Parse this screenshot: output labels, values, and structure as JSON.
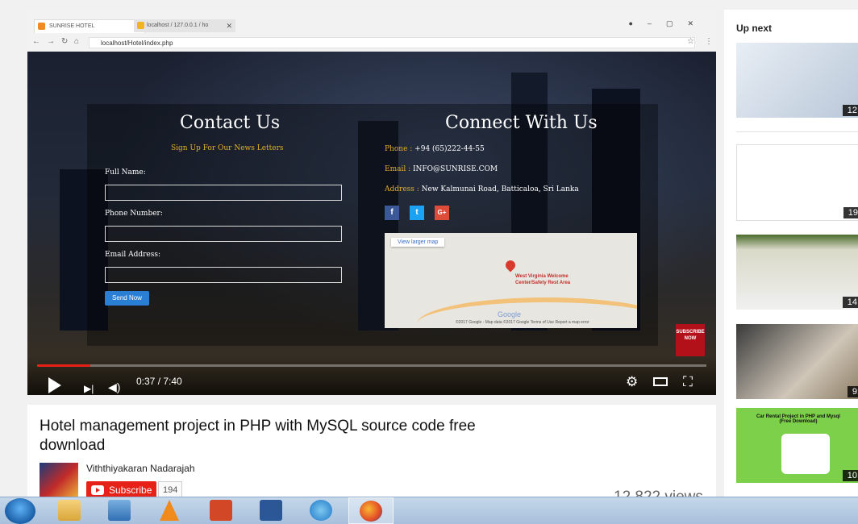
{
  "browser": {
    "tabs": [
      {
        "label": "SUNRISE HOTEL",
        "close": "✕"
      },
      {
        "label": "localhost / 127.0.0.1 / ho",
        "close": "✕"
      }
    ],
    "address": "localhost/Hotel/index.php"
  },
  "site": {
    "contact_title": "Contact Us",
    "newsletter_text": "Sign Up For Our News Letters",
    "fields": [
      {
        "label": "Full Name:"
      },
      {
        "label": "Phone Number:"
      },
      {
        "label": "Email Address:"
      }
    ],
    "send_label": "Send Now",
    "connect_title": "Connect With Us",
    "phone": {
      "label": "Phone :",
      "value": "+94 (65)222-44-55"
    },
    "email": {
      "label": "Email :",
      "value": "INFO@SUNRISE.COM"
    },
    "address": {
      "label": "Address :",
      "value": "New Kalmunai Road, Batticaloa, Sri Lanka"
    },
    "social": [
      {
        "glyph": "f",
        "color": "#3b5998"
      },
      {
        "glyph": "t",
        "color": "#1da1f2"
      },
      {
        "glyph": "G+",
        "color": "#dd4b39"
      }
    ],
    "map": {
      "larger_map": "View larger map",
      "place": "West Virginia Welcome Center/Safety Rest Area",
      "google": "Google",
      "footer": "©2017 Google - Map data ©2017 Google   Terms of Use   Report a map error"
    },
    "subscribe_badge": "SUBSCRIBE NOW"
  },
  "player": {
    "time": "0:37 / 7:40",
    "progress_fraction": 0.08
  },
  "video": {
    "title": "Hotel management project in PHP with MySQL source code free download",
    "channel": "Viththiyakaran Nadarajah",
    "subscribe_label": "Subscribe",
    "subscriber_count": "194",
    "views": "12,822 views"
  },
  "sidebar": {
    "heading": "Up next",
    "items": [
      {
        "duration": "12:"
      },
      {
        "duration": "19:"
      },
      {
        "duration": "14:"
      },
      {
        "duration": "9:"
      },
      {
        "duration": "10:",
        "title": "Car Rental Project in PHP and Mysql (Free Download)"
      }
    ]
  },
  "taskbar": {
    "apps": [
      "windows-explorer",
      "media-player",
      "vlc",
      "powerpoint",
      "word",
      "internet-explorer",
      "firefox"
    ]
  }
}
